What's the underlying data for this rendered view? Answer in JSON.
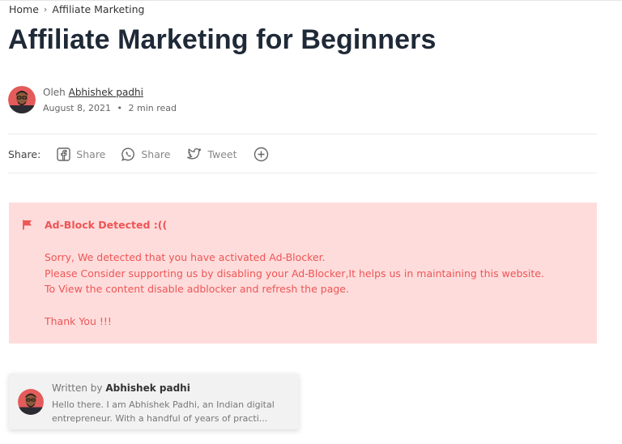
{
  "breadcrumb": {
    "home": "Home",
    "separator": "›",
    "current": "Affiliate Marketing"
  },
  "page": {
    "title": "Affiliate Marketing for Beginners"
  },
  "author": {
    "prefix": "Oleh",
    "name": "Abhishek padhi",
    "date": "August 8, 2021",
    "dot": "•",
    "read_time": "2 min read"
  },
  "share": {
    "label": "Share:",
    "facebook": "Share",
    "whatsapp": "Share",
    "twitter": "Tweet",
    "icons": [
      "facebook-icon",
      "whatsapp-icon",
      "twitter-icon",
      "plus-circle-icon"
    ]
  },
  "adblock": {
    "title": "Ad-Block Detected :((",
    "line1": "Sorry, We detected that you have activated Ad-Blocker.",
    "line2": "Please Consider supporting us by disabling your Ad-Blocker,It helps us in maintaining this website.",
    "line3": "To View the content disable adblocker and refresh the page.",
    "thanks": "Thank You !!!",
    "icon": "flag-icon",
    "colors": {
      "background": "#ffdcdc",
      "text": "#ee5555"
    }
  },
  "author_card": {
    "written_by": "Written by",
    "name": "Abhishek padhi",
    "bio": "Hello there. I am Abhishek Padhi, an Indian digital entrepreneur. With a handful of years of practi..."
  }
}
